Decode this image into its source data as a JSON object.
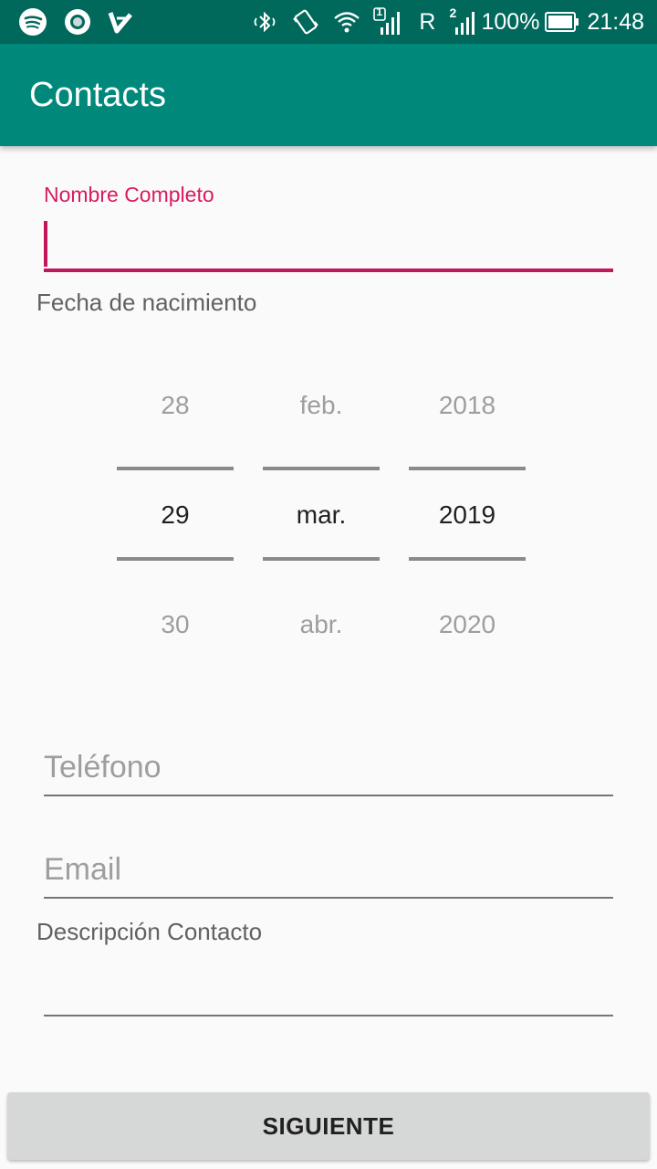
{
  "status_bar": {
    "left_icons": [
      "spotify-icon",
      "circle-app-icon",
      "checkmark-app-icon"
    ],
    "right_icons": [
      "bluetooth-icon",
      "vibrate-icon",
      "wifi-icon",
      "signal-sim1-icon",
      "signal-sim2-icon",
      "battery-icon"
    ],
    "sim1_label": "1",
    "roaming": "R",
    "sim2_label": "2",
    "battery": "100%",
    "time": "21:48"
  },
  "app_bar": {
    "title": "Contacts"
  },
  "form": {
    "name_label": "Nombre Completo",
    "name_value": "",
    "birthdate_label": "Fecha de nacimiento",
    "date_picker": {
      "day": {
        "prev": "28",
        "selected": "29",
        "next": "30"
      },
      "month": {
        "prev": "feb.",
        "selected": "mar.",
        "next": "abr."
      },
      "year": {
        "prev": "2018",
        "selected": "2019",
        "next": "2020"
      }
    },
    "phone_placeholder": "Teléfono",
    "email_placeholder": "Email",
    "description_label": "Descripción Contacto",
    "description_value": ""
  },
  "actions": {
    "next_label": "SIGUIENTE"
  },
  "colors": {
    "status_bar": "#00695c",
    "app_bar": "#00897b",
    "accent": "#d81b60",
    "button_bg": "#d6d7d7"
  }
}
